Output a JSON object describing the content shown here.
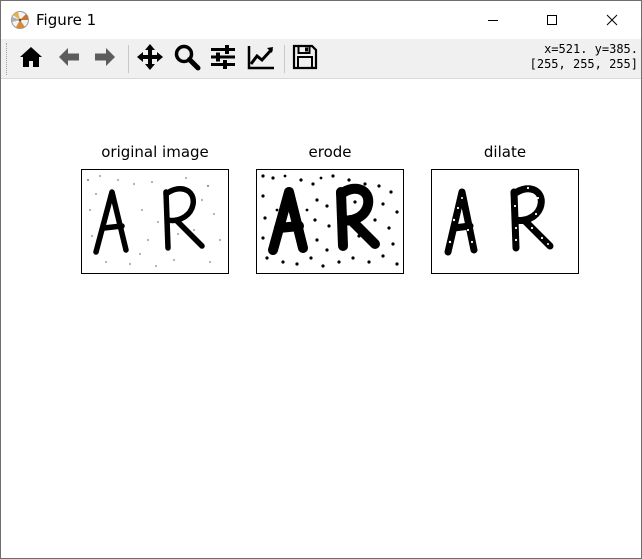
{
  "window": {
    "title": "Figure 1",
    "app_icon": "matplotlib-logo-icon",
    "controls": [
      "minimize-icon",
      "maximize-icon",
      "close-icon"
    ]
  },
  "toolbar": {
    "buttons": [
      {
        "name": "home-button",
        "icon": "home-icon"
      },
      {
        "name": "back-button",
        "icon": "arrow-left-icon"
      },
      {
        "name": "forward-button",
        "icon": "arrow-right-icon"
      },
      {
        "name": "pan-button",
        "icon": "move-icon"
      },
      {
        "name": "zoom-button",
        "icon": "magnifier-icon"
      },
      {
        "name": "subplots-button",
        "icon": "sliders-icon"
      },
      {
        "name": "edit-axis-button",
        "icon": "line-chart-icon"
      },
      {
        "name": "save-button",
        "icon": "floppy-disk-icon"
      }
    ],
    "coords_line1": "x=521. y=385.",
    "coords_line2": "[255, 255, 255]"
  },
  "figure": {
    "subplots": [
      {
        "title": "original image",
        "content_text": "AR",
        "variant": "speckled-background"
      },
      {
        "title": "erode",
        "content_text": "AR",
        "variant": "thick-strokes-dark-dots"
      },
      {
        "title": "dilate",
        "content_text": "AR",
        "variant": "thin-strokes-white-holes"
      }
    ]
  },
  "colors": {
    "titlebar_bg": "#ffffff",
    "toolbar_bg": "#f0f0f0",
    "canvas_bg": "#ffffff",
    "ink": "#000000"
  }
}
